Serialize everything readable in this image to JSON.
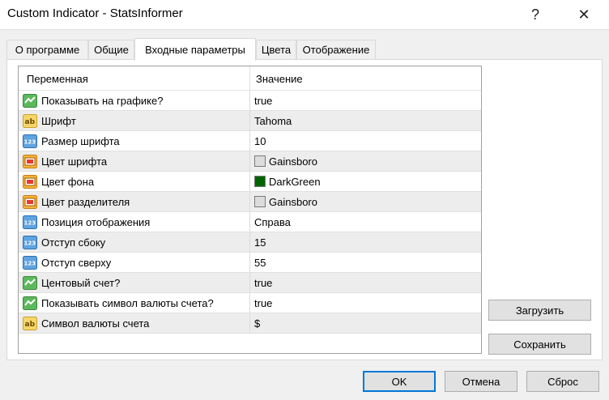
{
  "window": {
    "title": "Custom Indicator - StatsInformer",
    "help": "?",
    "close": "✕"
  },
  "tabs": [
    {
      "label": "О программе"
    },
    {
      "label": "Общие"
    },
    {
      "label": "Входные параметры"
    },
    {
      "label": "Цвета"
    },
    {
      "label": "Отображение"
    }
  ],
  "grid": {
    "col_variable": "Переменная",
    "col_value": "Значение",
    "rows": [
      {
        "icon": "bool-icon",
        "name": "Показывать на графике?",
        "value": "true"
      },
      {
        "icon": "string-icon",
        "name": "Шрифт",
        "value": "Tahoma"
      },
      {
        "icon": "int-icon",
        "name": "Размер шрифта",
        "value": "10"
      },
      {
        "icon": "color-icon",
        "name": "Цвет шрифта",
        "value": "Gainsboro",
        "color": "#dcdcdc"
      },
      {
        "icon": "color-icon",
        "name": "Цвет фона",
        "value": "DarkGreen",
        "color": "#006400"
      },
      {
        "icon": "color-icon",
        "name": "Цвет разделителя",
        "value": "Gainsboro",
        "color": "#dcdcdc"
      },
      {
        "icon": "int-icon",
        "name": "Позиция отображения",
        "value": "Справа"
      },
      {
        "icon": "int-icon",
        "name": "Отступ сбоку",
        "value": "15"
      },
      {
        "icon": "int-icon",
        "name": "Отступ сверху",
        "value": "55"
      },
      {
        "icon": "bool-icon",
        "name": "Центовый счет?",
        "value": "true"
      },
      {
        "icon": "bool-icon",
        "name": "Показывать символ валюты счета?",
        "value": "true"
      },
      {
        "icon": "string-icon",
        "name": "Символ валюты счета",
        "value": "$"
      }
    ]
  },
  "side_buttons": {
    "load": "Загрузить",
    "save": "Сохранить"
  },
  "footer": {
    "ok": "OK",
    "cancel": "Отмена",
    "reset": "Сброс"
  },
  "colors": {
    "accent": "#0078d7",
    "alt_row": "#ededed"
  }
}
